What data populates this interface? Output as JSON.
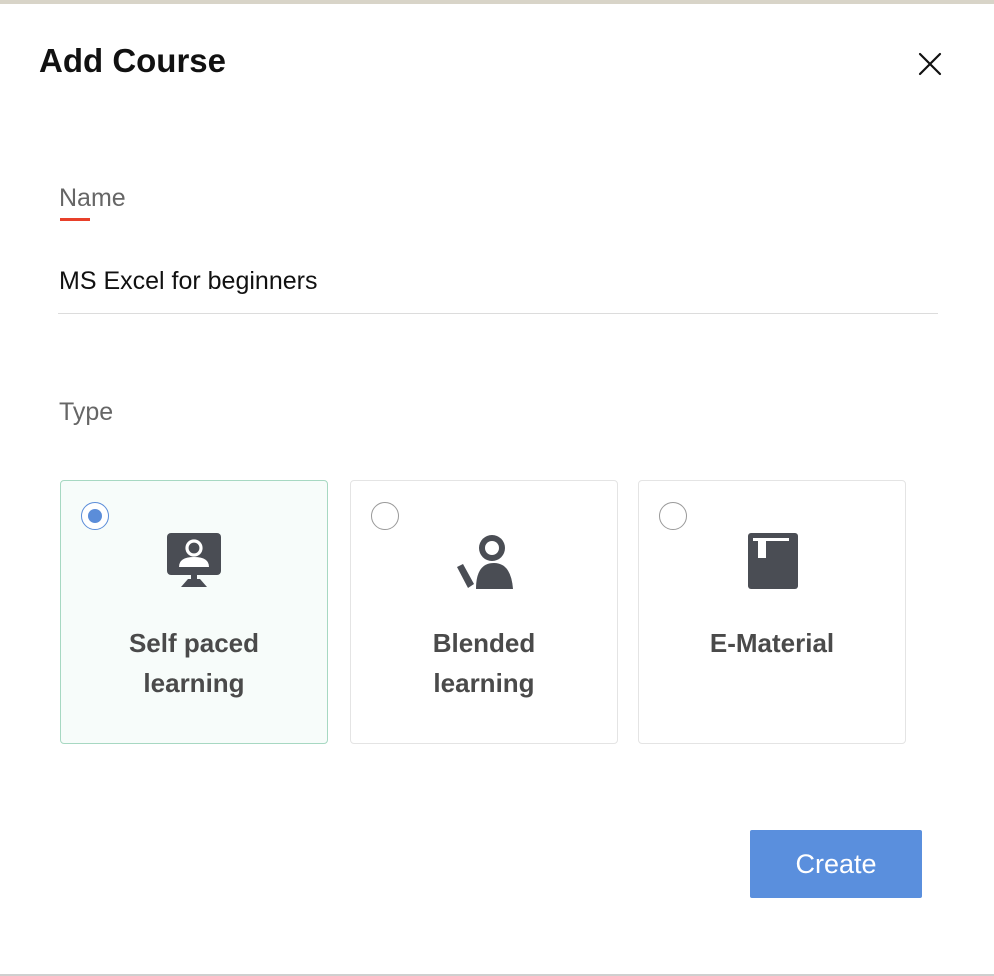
{
  "dialog": {
    "title": "Add Course",
    "close_icon": "close-icon"
  },
  "name_field": {
    "label": "Name",
    "value": "MS Excel for beginners",
    "accent_color": "#e8402a"
  },
  "type_field": {
    "label": "Type",
    "options": [
      {
        "label": "Self paced\nlearning",
        "icon": "monitor-person-icon",
        "selected": true
      },
      {
        "label": "Blended\nlearning",
        "icon": "person-pointer-icon",
        "selected": false
      },
      {
        "label": "E-Material",
        "icon": "book-icon",
        "selected": false
      }
    ]
  },
  "actions": {
    "create_label": "Create",
    "create_color": "#5a8fdd"
  }
}
